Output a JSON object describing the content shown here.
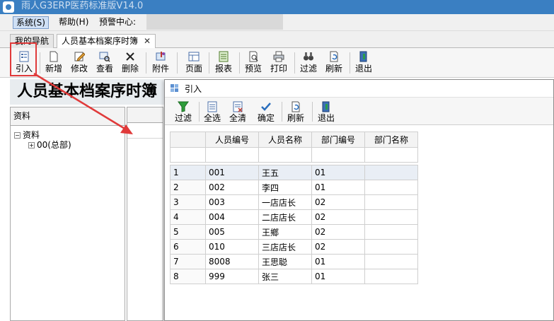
{
  "window": {
    "title": "雨人G3ERP医药标准版V14.0"
  },
  "menu": {
    "system": "系统(S)",
    "help": "帮助(H)",
    "alert_center": "预警中心:"
  },
  "tabs": [
    {
      "label": "我的导航"
    },
    {
      "label": "人员基本档案序时簿"
    }
  ],
  "toolbar": {
    "import": "引入",
    "new": "新增",
    "edit": "修改",
    "view": "查看",
    "delete": "删除",
    "attach": "附件",
    "page": "页面",
    "report": "报表",
    "preview": "预览",
    "print": "打印",
    "filter": "过滤",
    "refresh": "刷新",
    "exit": "退出"
  },
  "page": {
    "title": "人员基本档案序时簿"
  },
  "left_panel": {
    "header": "资料",
    "tree": [
      {
        "label": "资料",
        "expanded": true
      },
      {
        "label": "00(总部)",
        "expanded": false
      }
    ]
  },
  "dialog": {
    "title": "引入",
    "toolbar": {
      "filter": "过滤",
      "select_all": "全选",
      "clear_all": "全清",
      "confirm": "确定",
      "refresh": "刷新",
      "exit": "退出"
    },
    "columns": [
      "人员编号",
      "人员名称",
      "部门编号",
      "部门名称"
    ],
    "rows": [
      {
        "n": "1",
        "code": "001",
        "name": "王五",
        "dept": "01",
        "dept_name": ""
      },
      {
        "n": "2",
        "code": "002",
        "name": "李四",
        "dept": "01",
        "dept_name": ""
      },
      {
        "n": "3",
        "code": "003",
        "name": "一店店长",
        "dept": "02",
        "dept_name": ""
      },
      {
        "n": "4",
        "code": "004",
        "name": "二店店长",
        "dept": "02",
        "dept_name": ""
      },
      {
        "n": "5",
        "code": "005",
        "name": "王鄉",
        "dept": "02",
        "dept_name": ""
      },
      {
        "n": "6",
        "code": "010",
        "name": "三店店长",
        "dept": "02",
        "dept_name": ""
      },
      {
        "n": "7",
        "code": "8008",
        "name": "王思聪",
        "dept": "01",
        "dept_name": ""
      },
      {
        "n": "8",
        "code": "999",
        "name": "张三",
        "dept": "01",
        "dept_name": ""
      }
    ]
  },
  "colors": {
    "highlight": "#e03a3a",
    "titlebar": "#3a7fc2"
  }
}
